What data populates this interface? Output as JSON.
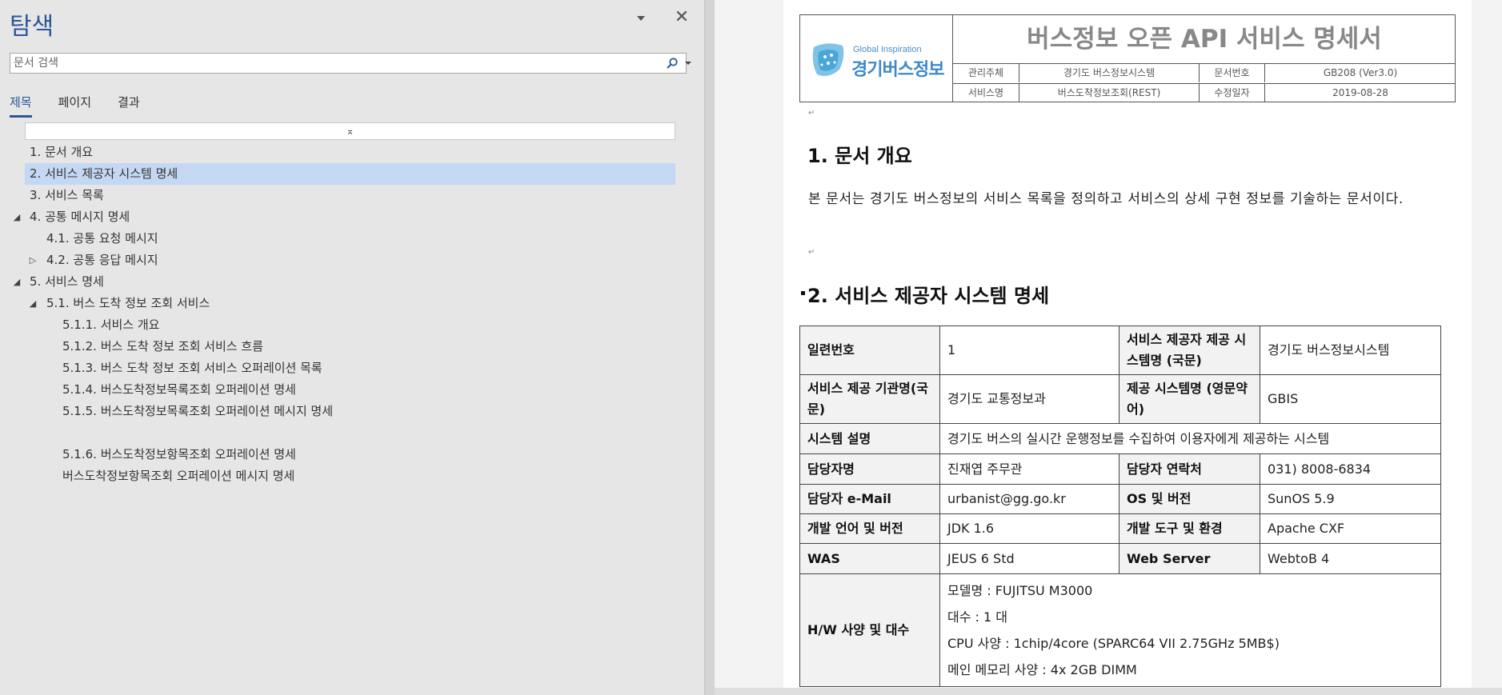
{
  "nav": {
    "title": "탐색",
    "search_placeholder": "문서 검색",
    "tabs": [
      "제목",
      "페이지",
      "결과"
    ],
    "top_marker": "⌅",
    "headings": [
      {
        "label": "1. 문서 개요"
      },
      {
        "label": "2. 서비스 제공자 시스템 명세"
      },
      {
        "label": "3. 서비스 목록"
      },
      {
        "label": "4. 공통 메시지 명세"
      },
      {
        "label": "4.1. 공통 요청 메시지"
      },
      {
        "label": "4.2. 공통 응답 메시지"
      },
      {
        "label": "5. 서비스 명세"
      },
      {
        "label": "5.1. 버스 도착 정보 조회 서비스"
      },
      {
        "label": "5.1.1. 서비스 개요"
      },
      {
        "label": "5.1.2. 버스 도착 정보 조회 서비스 흐름"
      },
      {
        "label": "5.1.3. 버스 도착 정보 조회 서비스 오퍼레이션 목록"
      },
      {
        "label": "5.1.4. 버스도착정보목록조회 오퍼레이션 명세"
      },
      {
        "label": "5.1.5. 버스도착정보목록조회 오퍼레이션 메시지 명세"
      },
      {
        "label": "5.1.6. 버스도착정보항목조회 오퍼레이션 명세"
      },
      {
        "label": "버스도착정보항목조회 오퍼레이션 메시지 명세"
      }
    ]
  },
  "doc": {
    "logo_tagline": "Global Inspiration",
    "logo_name": "경기버스정보",
    "title": "버스정보 오픈 API 서비스 명세서",
    "meta": {
      "owner_label": "관리주체",
      "owner_value": "경기도 버스정보시스템",
      "docno_label": "문서번호",
      "docno_value": "GB208 (Ver3.0)",
      "service_label": "서비스명",
      "service_value": "버스도착정보조회(REST)",
      "date_label": "수정일자",
      "date_value": "2019-08-28"
    },
    "section1_title": "1. 문서 개요",
    "section1_body": "본 문서는 경기도 버스정보의 서비스 목록을 정의하고 서비스의 상세 구현 정보를 기술하는 문서이다.",
    "section2_title": "2. 서비스 제공자 시스템 명세",
    "spec": {
      "serial_label": "일련번호",
      "serial_value": "1",
      "sysname_ko_label": "서비스 제공자 제공 시스템명 (국문)",
      "sysname_ko_value": "경기도 버스정보시스템",
      "org_label": "서비스 제공 기관명(국문)",
      "org_value": "경기도 교통정보과",
      "sysname_en_label": "제공 시스템명 (영문약어)",
      "sysname_en_value": "GBIS",
      "desc_label": "시스템 설명",
      "desc_value": "경기도 버스의 실시간 운행정보를 수집하여 이용자에게 제공하는 시스템",
      "manager_label": "담당자명",
      "manager_value": "진재엽 주무관",
      "contact_label": "담당자 연락처",
      "contact_value": "031) 8008-6834",
      "email_label": "담당자 e-Mail",
      "email_value": "urbanist@gg.go.kr",
      "os_label": "OS 및 버전",
      "os_value": "SunOS 5.9",
      "lang_label": "개발 언어 및 버전",
      "lang_value": "JDK 1.6",
      "tool_label": "개발 도구 및 환경",
      "tool_value": "Apache CXF",
      "was_label": "WAS",
      "was_value": "JEUS 6 Std",
      "web_label": "Web Server",
      "web_value": "WebtoB 4",
      "hw_label": "H/W 사양 및 대수",
      "hw_lines": [
        "모델명 : FUJITSU M3000",
        "대수 : 1 대",
        "CPU 사양 : 1chip/4core (SPARC64 VII   2.75GHz   5MB$)",
        "메인 메모리 사양 : 4x 2GB DIMM"
      ]
    }
  }
}
